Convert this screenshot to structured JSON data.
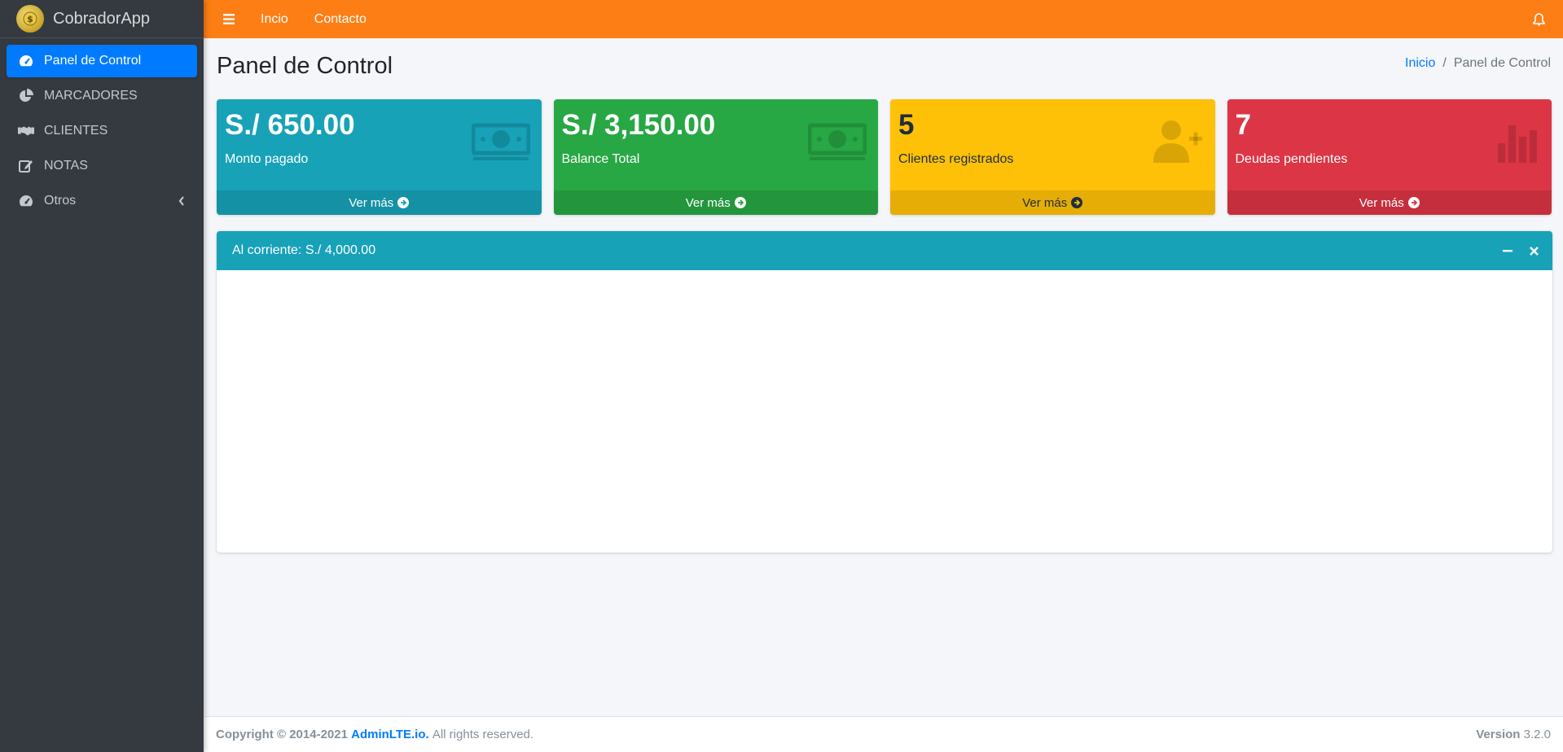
{
  "brand": {
    "name": "CobradorApp"
  },
  "sidebar": {
    "items": [
      {
        "label": "Panel de Control",
        "icon": "tachometer-icon",
        "active": true
      },
      {
        "label": "MARCADORES",
        "icon": "chart-pie-icon"
      },
      {
        "label": "CLIENTES",
        "icon": "handshake-icon"
      },
      {
        "label": "NOTAS",
        "icon": "edit-icon"
      },
      {
        "label": "Otros",
        "icon": "tachometer-icon",
        "has_children": true
      }
    ]
  },
  "topbar": {
    "links": [
      "Incio",
      "Contacto"
    ],
    "menu_icon": "bars-icon",
    "notification_icon": "bell-icon",
    "color": "#fd7e14"
  },
  "page": {
    "title": "Panel de Control",
    "breadcrumb": {
      "home": "Inicio",
      "separator": "/",
      "current": "Panel de Control"
    }
  },
  "cards": [
    {
      "value": "S./ 650.00",
      "label": "Monto pagado",
      "more": "Ver más",
      "icon": "money-bill-icon",
      "color": "#17a2b8"
    },
    {
      "value": "S./ 3,150.00",
      "label": "Balance Total",
      "more": "Ver más",
      "icon": "money-bill-icon",
      "color": "#28a745"
    },
    {
      "value": "5",
      "label": "Clientes registrados",
      "more": "Ver más",
      "icon": "user-plus-icon",
      "color": "#ffc107"
    },
    {
      "value": "7",
      "label": "Deudas pendientes",
      "more": "Ver más",
      "icon": "bar-chart-icon",
      "color": "#dc3545"
    }
  ],
  "panel": {
    "title": "Al corriente: S./ 4,000.00"
  },
  "footer": {
    "copyright": "Copyright © 2014-2021",
    "link": "AdminLTE.io.",
    "rights": "All rights reserved.",
    "version_label": "Version",
    "version": "3.2.0"
  }
}
